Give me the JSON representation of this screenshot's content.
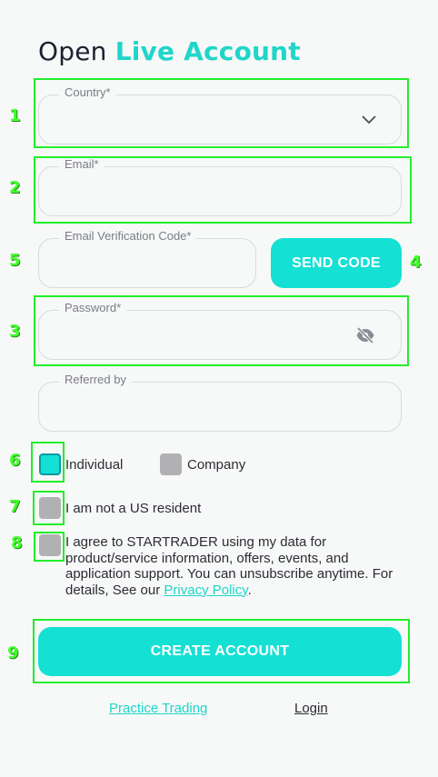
{
  "title": {
    "prefix": "Open",
    "accent": "Live Account"
  },
  "fields": {
    "country": {
      "label": "Country*",
      "value": ""
    },
    "email": {
      "label": "Email*",
      "value": ""
    },
    "code": {
      "label": "Email Verification Code*",
      "value": ""
    },
    "password": {
      "label": "Password*",
      "value": ""
    },
    "referred": {
      "label": "Referred by",
      "value": ""
    }
  },
  "send_code_label": "SEND CODE",
  "account_type": {
    "individual": "Individual",
    "company": "Company",
    "selected": "Individual"
  },
  "us_resident_label": "I am not a US resident",
  "agree": {
    "text": "I agree to STARTRADER using my data for product/service information, offers, events, and application support. You can unsubscribe anytime. For details, See our ",
    "link": "Privacy Policy",
    "end": "."
  },
  "create_label": "CREATE ACCOUNT",
  "links": {
    "practice": "Practice Trading",
    "login": "Login"
  },
  "annotations": {
    "n1": "1",
    "n2": "2",
    "n3": "3",
    "n4": "4",
    "n5": "5",
    "n6": "6",
    "n7": "7",
    "n8": "8",
    "n9": "9"
  },
  "colors": {
    "accent": "#14e0d4",
    "highlight": "#22ee2a",
    "checkbox_gray": "#b1b1b3"
  },
  "icons": {
    "country": "chevron-down-icon",
    "password": "eye-off-icon"
  }
}
